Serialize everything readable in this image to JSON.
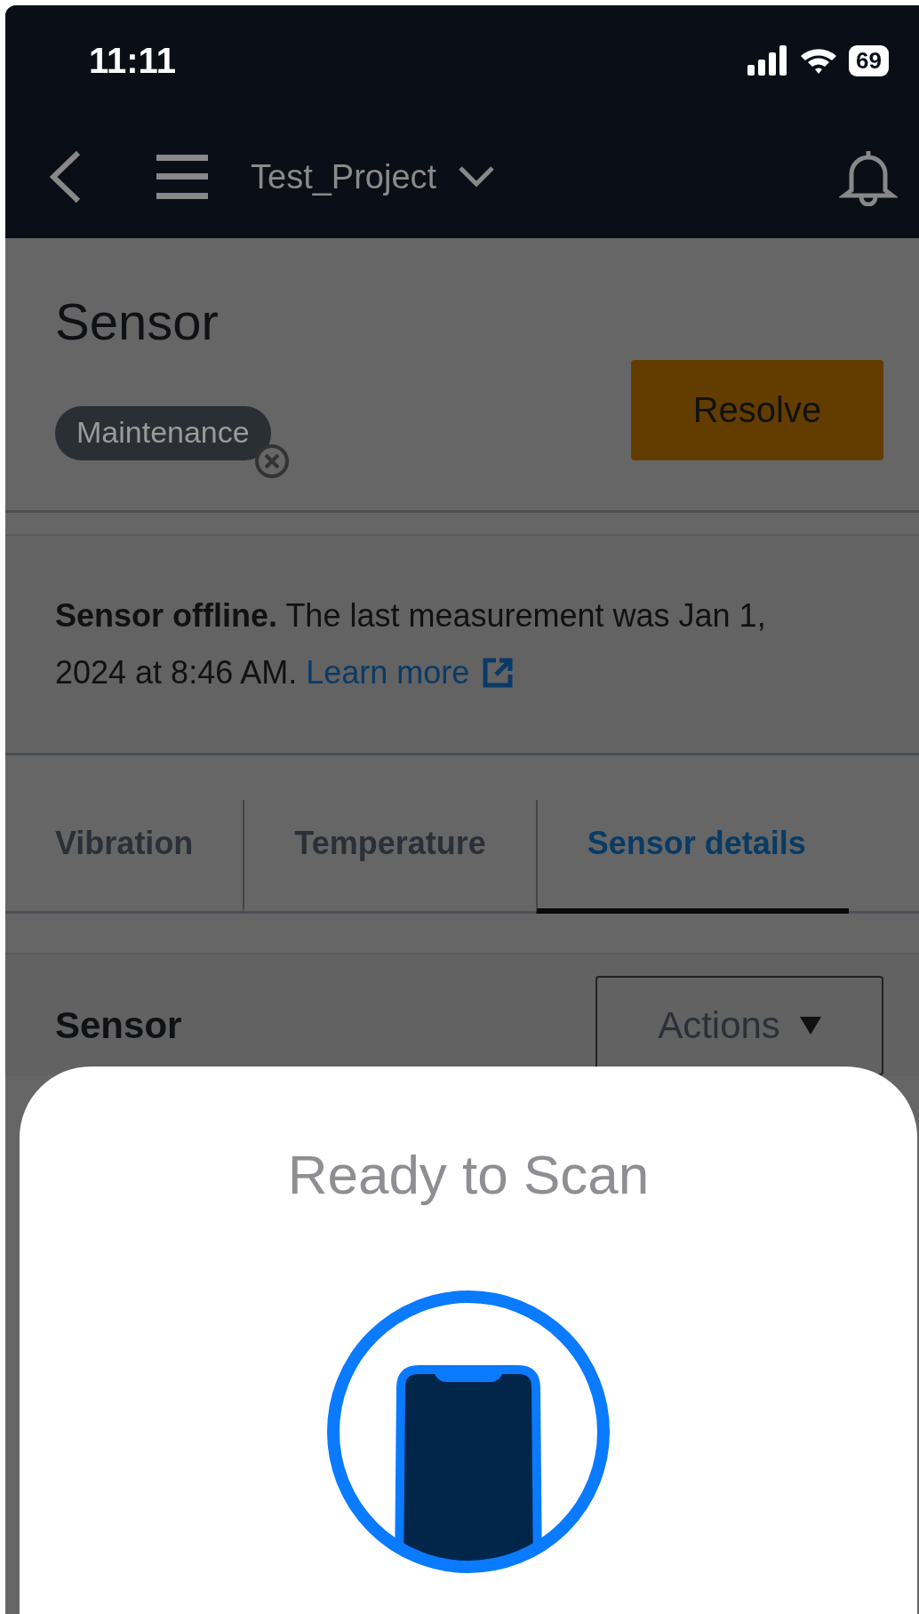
{
  "status_bar": {
    "time": "11:11",
    "battery": "69"
  },
  "nav": {
    "project": "Test_Project"
  },
  "header": {
    "title": "Sensor",
    "tag": "Maintenance",
    "primary_button": "Resolve"
  },
  "alert": {
    "text": "**Sensor offline.** The last measurement was Jan 1, 2024 at 8:46 AM.",
    "link": "Learn more"
  },
  "tabs": [
    {
      "label": "Vibration",
      "selected": false
    },
    {
      "label": "Temperature",
      "selected": false
    },
    {
      "label": "Sensor details",
      "selected": true
    }
  ],
  "section": {
    "title": "Sensor",
    "actions_button": "Actions"
  },
  "sheet": {
    "title": "Ready to Scan"
  }
}
